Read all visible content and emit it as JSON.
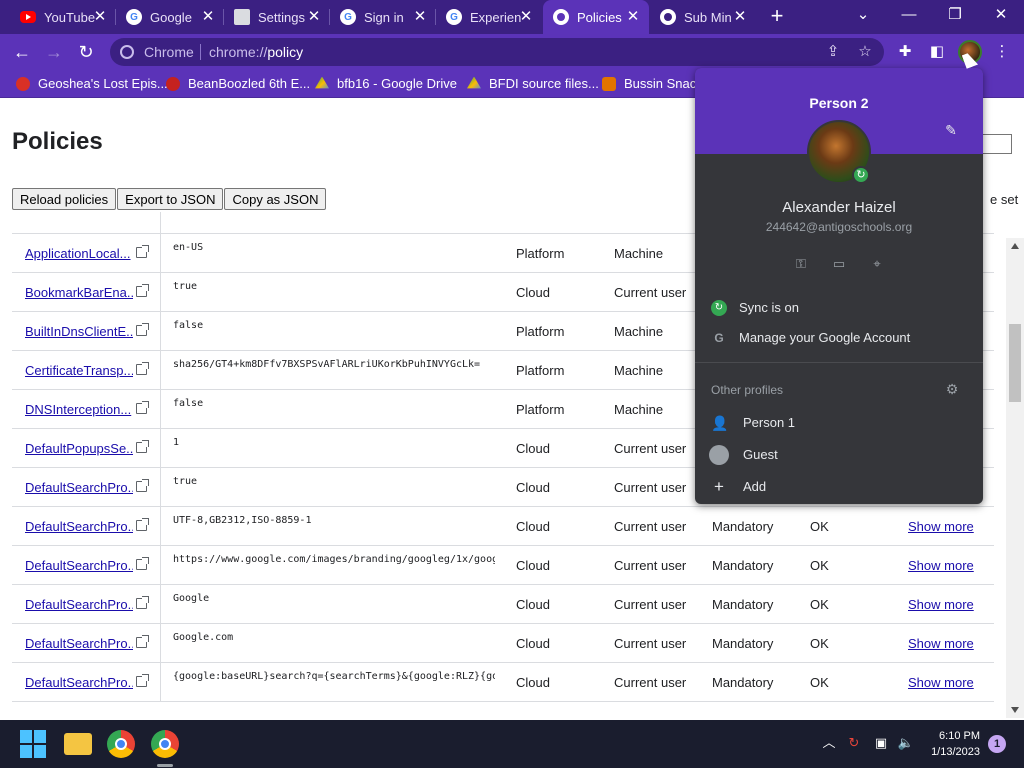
{
  "window": {
    "tabs": [
      {
        "title": "YouTube",
        "icon": "youtube-icon",
        "color": "#ff0000",
        "active": false
      },
      {
        "title": "Google",
        "icon": "google-icon",
        "color": "#4285f4",
        "active": false
      },
      {
        "title": "Settings",
        "icon": "sheets-icon",
        "color": "#9aa0a6",
        "active": false
      },
      {
        "title": "Sign in",
        "icon": "google-icon",
        "color": "#4285f4",
        "active": false
      },
      {
        "title": "Experien",
        "icon": "google-icon",
        "color": "#4285f4",
        "active": false
      },
      {
        "title": "Policies",
        "icon": "chrome-globe-icon",
        "color": "#ffffff",
        "active": true
      },
      {
        "title": "Sub Min",
        "icon": "globe-icon",
        "color": "#ffffff",
        "active": false
      }
    ]
  },
  "toolbar": {
    "site_label": "Chrome",
    "url_scheme": "chrome://",
    "url_path": "policy"
  },
  "bookmarks": [
    {
      "label": "Geoshea's Lost Epis...",
      "icon": "bookmark-red-icon",
      "color": "#d93025"
    },
    {
      "label": "BeanBoozled 6th E...",
      "icon": "bookmark-bean-icon",
      "color": "#c5221f"
    },
    {
      "label": "bfb16 - Google Drive",
      "icon": "drive-icon",
      "color": "#fbbc04"
    },
    {
      "label": "BFDI source files...",
      "icon": "drive-icon",
      "color": "#fbbc04"
    },
    {
      "label": "Bussin Snack",
      "icon": "bookmark-snack-icon",
      "color": "#e37400"
    }
  ],
  "page": {
    "title": "Policies",
    "buttons": {
      "reload": "Reload policies",
      "export": "Export to JSON",
      "copy": "Copy as JSON"
    },
    "set_label": "e set",
    "rows": [
      {
        "name": "ApplicationLocal...",
        "value": "en-US",
        "source": "Platform",
        "scope": "Machine",
        "level": "",
        "status": "",
        "more": ""
      },
      {
        "name": "BookmarkBarEna...",
        "value": "true",
        "source": "Cloud",
        "scope": "Current user",
        "level": "",
        "status": "",
        "more": ""
      },
      {
        "name": "BuiltInDnsClientE...",
        "value": "false",
        "source": "Platform",
        "scope": "Machine",
        "level": "",
        "status": "",
        "more": ""
      },
      {
        "name": "CertificateTransp...",
        "value": "sha256/GT4+km8DFfv7BXSPSvAFlARLriUKorKbPuhINVYGcLk=",
        "source": "Platform",
        "scope": "Machine",
        "level": "",
        "status": "",
        "more": ""
      },
      {
        "name": "DNSInterception...",
        "value": "false",
        "source": "Platform",
        "scope": "Machine",
        "level": "",
        "status": "",
        "more": ""
      },
      {
        "name": "DefaultPopupsSe...",
        "value": "1",
        "source": "Cloud",
        "scope": "Current user",
        "level": "",
        "status": "",
        "more": ""
      },
      {
        "name": "DefaultSearchPro...",
        "value": "true",
        "source": "Cloud",
        "scope": "Current user",
        "level": "Mandatory",
        "status": "OK",
        "more": "Show more"
      },
      {
        "name": "DefaultSearchPro...",
        "value": "UTF-8,GB2312,ISO-8859-1",
        "source": "Cloud",
        "scope": "Current user",
        "level": "Mandatory",
        "status": "OK",
        "more": "Show more"
      },
      {
        "name": "DefaultSearchPro...",
        "value": "https://www.google.com/images/branding/googleg/1x/goog...",
        "source": "Cloud",
        "scope": "Current user",
        "level": "Mandatory",
        "status": "OK",
        "more": "Show more"
      },
      {
        "name": "DefaultSearchPro...",
        "value": "Google",
        "source": "Cloud",
        "scope": "Current user",
        "level": "Mandatory",
        "status": "OK",
        "more": "Show more"
      },
      {
        "name": "DefaultSearchPro...",
        "value": "Google.com",
        "source": "Cloud",
        "scope": "Current user",
        "level": "Mandatory",
        "status": "OK",
        "more": "Show more"
      },
      {
        "name": "DefaultSearchPro...",
        "value": "{google:baseURL}search?q={searchTerms}&{google:RLZ}{go...",
        "source": "Cloud",
        "scope": "Current user",
        "level": "Mandatory",
        "status": "OK",
        "more": "Show more"
      }
    ]
  },
  "profile_menu": {
    "profile_name": "Person 2",
    "full_name": "Alexander Haizel",
    "email": "244642@antigoschools.org",
    "sync": "Sync is on",
    "manage": "Manage your Google Account",
    "other_profiles_label": "Other profiles",
    "profiles": [
      "Person 1",
      "Guest"
    ],
    "add": "Add"
  },
  "taskbar": {
    "time": "6:10 PM",
    "date": "1/13/2023",
    "notifications": "1"
  }
}
